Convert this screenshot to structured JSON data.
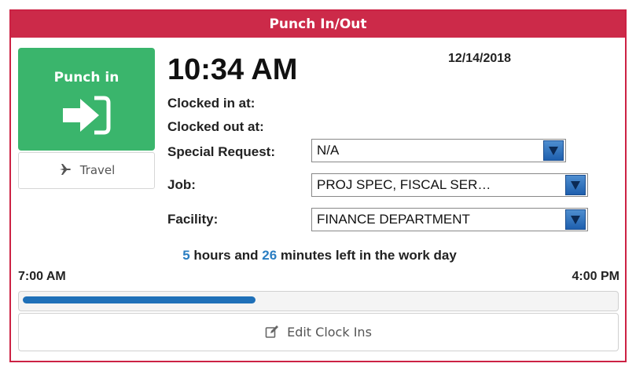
{
  "header": {
    "title": "Punch In/Out"
  },
  "punch": {
    "label": "Punch in",
    "icon": "sign-in-arrow-icon",
    "color": "#3ab56c"
  },
  "travel": {
    "label": "Travel",
    "icon": "plane-icon"
  },
  "clock": {
    "time": "10:34 AM",
    "date": "12/14/2018"
  },
  "labels": {
    "clocked_in": "Clocked in at:",
    "clocked_out": "Clocked out at:",
    "special_request": "Special Request:",
    "job": "Job:",
    "facility": "Facility:"
  },
  "selects": {
    "special_request": "N/A",
    "job": "PROJ SPEC, FISCAL SER…",
    "facility": "FINANCE DEPARTMENT"
  },
  "workday": {
    "hours_left": "5",
    "hours_text": " hours and ",
    "minutes_left": "26",
    "minutes_text": " minutes left in the work day",
    "start": "7:00 AM",
    "end": "4:00 PM",
    "progress_fraction": 0.393
  },
  "edit": {
    "label": "Edit Clock Ins",
    "icon": "edit-icon"
  },
  "colors": {
    "header": "#cc2a49",
    "accent": "#2a7ec2",
    "progress": "#1f70b8"
  }
}
